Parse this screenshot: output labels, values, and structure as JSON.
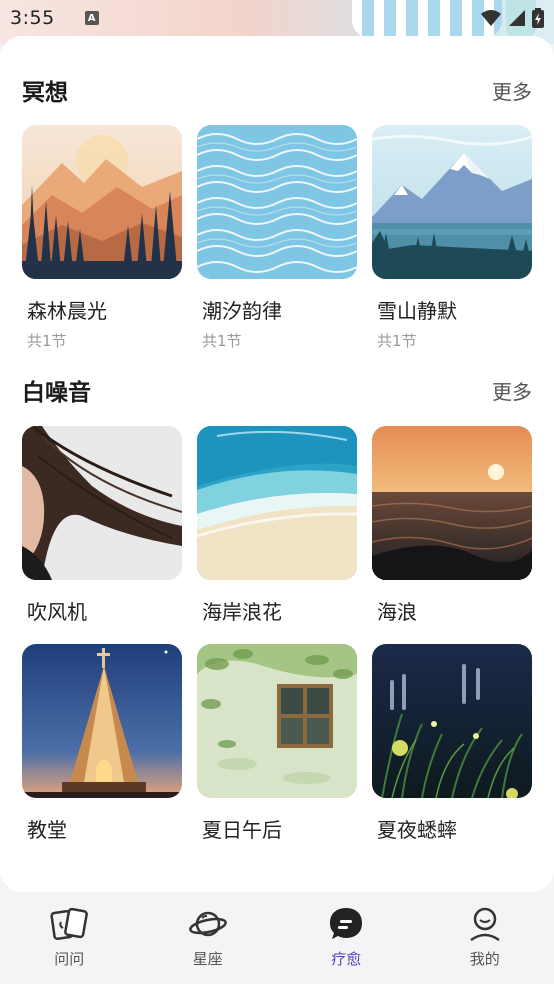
{
  "status_bar": {
    "time": "3:55",
    "notification_badge": "A"
  },
  "meditation": {
    "title": "冥想",
    "more_label": "更多",
    "items": [
      {
        "name": "森林晨光",
        "count": "共1节",
        "image": "forest-sunrise"
      },
      {
        "name": "潮汐韵律",
        "count": "共1节",
        "image": "ocean-waves-pattern"
      },
      {
        "name": "雪山静默",
        "count": "共1节",
        "image": "snow-mountain-lake"
      }
    ]
  },
  "white_noise": {
    "title": "白噪音",
    "more_label": "更多",
    "items": [
      {
        "name": "吹风机",
        "image": "woman-hair-blowing"
      },
      {
        "name": "海岸浪花",
        "image": "beach-shore-aerial"
      },
      {
        "name": "海浪",
        "image": "sunset-sea-waves"
      },
      {
        "name": "教堂",
        "image": "church-dusk"
      },
      {
        "name": "夏日午后",
        "image": "window-leaves-shadow"
      },
      {
        "name": "夏夜蟋蟀",
        "image": "fireflies-grass-night"
      }
    ]
  },
  "bottom_nav": {
    "items": [
      {
        "label": "问问",
        "icon": "cards-icon",
        "active": false
      },
      {
        "label": "星座",
        "icon": "planet-icon",
        "active": false
      },
      {
        "label": "疗愈",
        "icon": "chat-bubble-icon",
        "active": true
      },
      {
        "label": "我的",
        "icon": "profile-icon",
        "active": false
      }
    ]
  },
  "colors": {
    "accent": "#5a3fc0",
    "background": "#f4f4f6",
    "card": "#ffffff"
  }
}
